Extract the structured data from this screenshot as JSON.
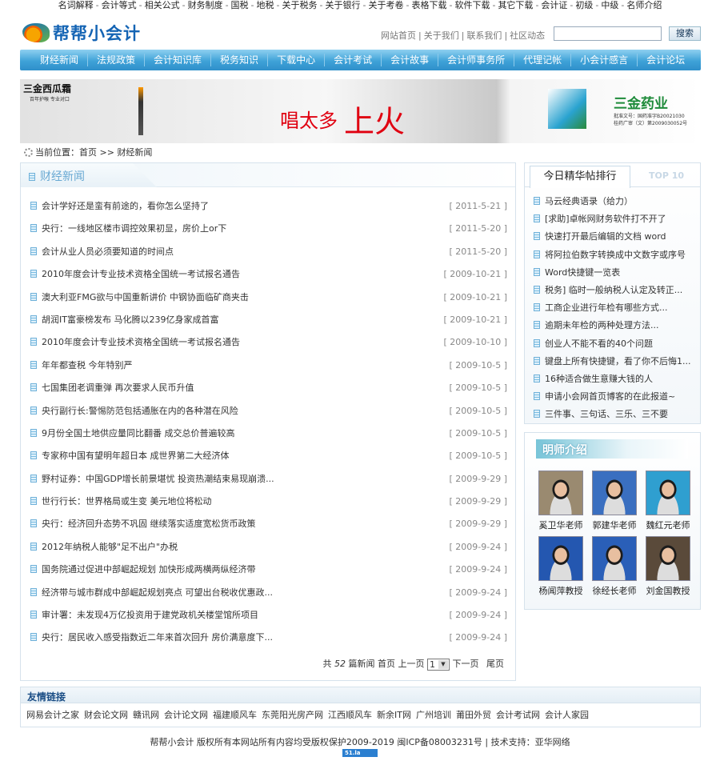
{
  "topnav": [
    "名词解释",
    "会计等式",
    "相关公式",
    "财务制度",
    "国税",
    "地税",
    "关于税务",
    "关于银行",
    "关于考卷",
    "表格下载",
    "软件下载",
    "其它下载",
    "会计证",
    "初级",
    "中级",
    "名师介绍"
  ],
  "topnav_sep": "-",
  "logo": "帮帮小会计",
  "toplinks": [
    "网站首页",
    "关于我们",
    "联系我们",
    "社区动态"
  ],
  "toplinks_sep": "|",
  "search": {
    "value": "",
    "button": "搜索"
  },
  "mainnav": [
    "财经新闻",
    "法规政策",
    "会计知识库",
    "税务知识",
    "下载中心",
    "会计考试",
    "会计故事",
    "会计师事务所",
    "代理记帐",
    "小会计感言",
    "会计论坛"
  ],
  "banner": {
    "brand_left": "三金西瓜霜",
    "brand_left_sub": "百年护喉 专业对口",
    "slogan": "唱太多",
    "slogan_big": "上火",
    "brand_right": "三金药业",
    "license1": "批准文号：国药准字B20021030",
    "license2": "桂药广审（文）第2009030052号"
  },
  "breadcrumb": {
    "label": "当前位置：",
    "home": "首页",
    "sep": " >> ",
    "current": "财经新闻"
  },
  "news": {
    "title": "财经新闻",
    "items": [
      {
        "title": "会计学好还是蛮有前途的，看你怎么坚持了",
        "date": "[ 2011-5-21 ]"
      },
      {
        "title": "央行：一线地区楼市调控效果初显，房价上or下",
        "date": "[ 2011-5-20 ]"
      },
      {
        "title": "会计从业人员必须要知道的时间点",
        "date": "[ 2011-5-20 ]"
      },
      {
        "title": "2010年度会计专业技术资格全国统一考试报名通告",
        "date": "[ 2009-10-21 ]"
      },
      {
        "title": "澳大利亚FMG欲与中国重新讲价 中钢协面临矿商夹击",
        "date": "[ 2009-10-21 ]"
      },
      {
        "title": "胡润IT富豪榜发布 马化腾以239亿身家成首富",
        "date": "[ 2009-10-21 ]"
      },
      {
        "title": "2010年度会计专业技术资格全国统一考试报名通告",
        "date": "[ 2009-10-10 ]"
      },
      {
        "title": "年年都查税 今年特别严",
        "date": "[ 2009-10-5 ]"
      },
      {
        "title": "七国集团老调重弹 再次要求人民币升值",
        "date": "[ 2009-10-5 ]"
      },
      {
        "title": "央行副行长:警惕防范包括通胀在内的各种潜在风险",
        "date": "[ 2009-10-5 ]"
      },
      {
        "title": "9月份全国土地供应量同比翻番 成交总价普遍较高",
        "date": "[ 2009-10-5 ]"
      },
      {
        "title": "专家称中国有望明年超日本 成世界第二大经济体",
        "date": "[ 2009-10-5 ]"
      },
      {
        "title": "野村证券：中国GDP增长前景堪忧 投资热潮结束易现崩溃...",
        "date": "[ 2009-9-29 ]"
      },
      {
        "title": "世行行长：世界格局或生变 美元地位将松动",
        "date": "[ 2009-9-29 ]"
      },
      {
        "title": "央行：经济回升态势不巩固 继续落实适度宽松货币政策",
        "date": "[ 2009-9-29 ]"
      },
      {
        "title": "2012年纳税人能够\"足不出户\"办税",
        "date": "[ 2009-9-24 ]"
      },
      {
        "title": "国务院通过促进中部崛起规划 加快形成两横两纵经济带",
        "date": "[ 2009-9-24 ]"
      },
      {
        "title": "经济带与城市群成中部崛起规划亮点 可望出台税收优惠政...",
        "date": "[ 2009-9-24 ]"
      },
      {
        "title": "审计署：未发现4万亿投资用于建党政机关楼堂馆所项目",
        "date": "[ 2009-9-24 ]"
      },
      {
        "title": "央行：居民收入感受指数近二年来首次回升 房价满意度下...",
        "date": "[ 2009-9-24 ]"
      }
    ]
  },
  "pager": {
    "prefix": "共",
    "total": "52",
    "suffix": "篇新闻",
    "first": "首页",
    "prev": "上一页",
    "page": "1",
    "next": "下一页",
    "last": "尾页"
  },
  "rank": {
    "tab_active": "今日精华帖排行",
    "tab_other": "TOP 10",
    "items": [
      "马云经典语录（给力）",
      "[求助]卓帐网财务软件打不开了",
      "快速打开最后编辑的文档 word",
      "将阿拉伯数字转换成中文数字或序号",
      "Word快捷键一览表",
      "税务] 临时一般纳税人认定及转正...",
      "工商企业进行年检有哪些方式...",
      "逾期未年检的两种处理方法...",
      "创业人不能不看的40个问题",
      "键盘上所有快捷键，看了你不后悔1...",
      "16种适合做生意赚大钱的人",
      "申请小会网首页博客的在此报道~",
      "三件事、三句话、三乐、三不要"
    ]
  },
  "teachers": {
    "title": "明师介绍",
    "items": [
      "奚卫华老师",
      "郭建华老师",
      "魏红元老师",
      "杨闻萍教授",
      "徐经长老师",
      "刘金国教授"
    ]
  },
  "friend_links": {
    "title": "友情链接",
    "items": [
      "网易会计之家",
      "财会论文网",
      "赣讯网",
      "会计论文网",
      "福建顺风车",
      "东莞阳光房产网",
      "江西顺风车",
      "新余IT网",
      "广州培训",
      "莆田外贸",
      "会计考试网",
      "会计人家园"
    ]
  },
  "footer": {
    "text": "帮帮小会计 版权所有本网站所有内容均受版权保护2009-2019 闽ICP备08003231号 | 技术支持：亚华网络",
    "badge": "51.la"
  }
}
